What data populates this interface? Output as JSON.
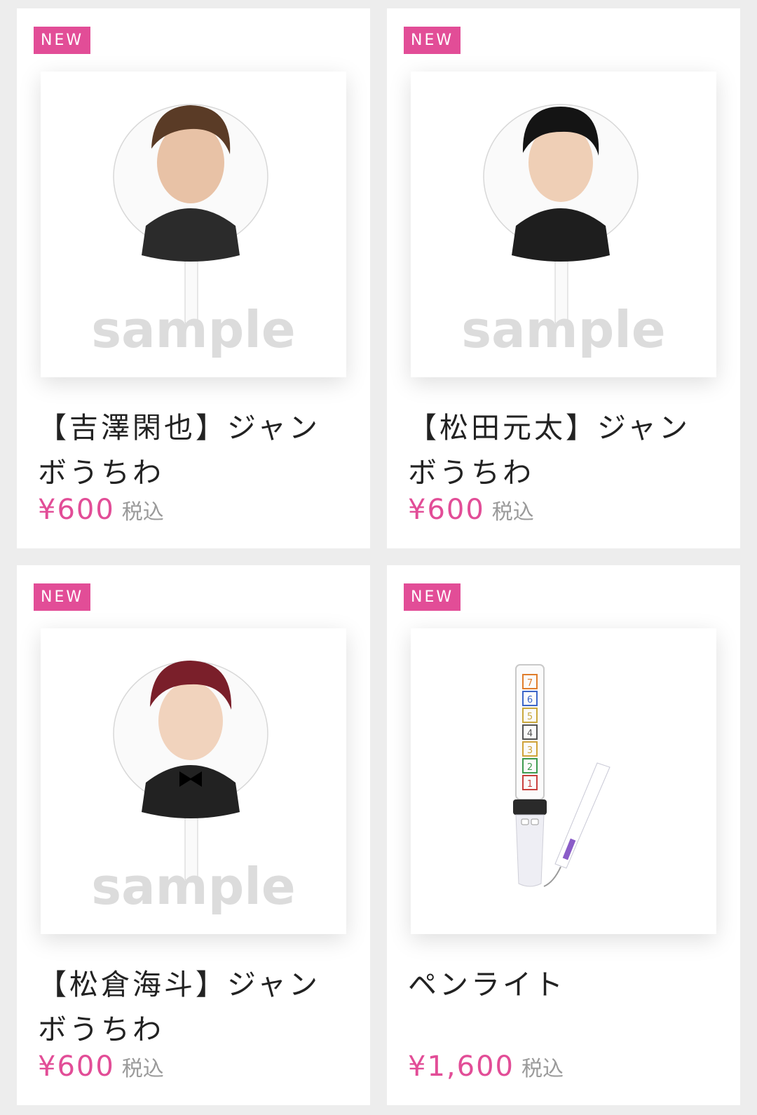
{
  "accent_color": "#e24d97",
  "products": [
    {
      "badge": "NEW",
      "title_line1": "【吉澤閑也】ジャン",
      "title_line2": "ボうちわ",
      "price": "¥600",
      "tax_label": "税込",
      "watermark": "sample",
      "image_icon": "uchiwa-fan-icon"
    },
    {
      "badge": "NEW",
      "title_line1": "【松田元太】ジャン",
      "title_line2": "ボうちわ",
      "price": "¥600",
      "tax_label": "税込",
      "watermark": "sample",
      "image_icon": "uchiwa-fan-icon"
    },
    {
      "badge": "NEW",
      "title_line1": "【松倉海斗】ジャン",
      "title_line2": "ボうちわ",
      "price": "¥600",
      "tax_label": "税込",
      "watermark": "sample",
      "image_icon": "uchiwa-fan-icon"
    },
    {
      "badge": "NEW",
      "title_line1": "ペンライト",
      "title_line2": "",
      "price": "¥1,600",
      "tax_label": "税込",
      "image_icon": "penlight-icon",
      "penlight_numbers": [
        "7",
        "6",
        "5",
        "4",
        "3",
        "2",
        "1"
      ]
    }
  ]
}
